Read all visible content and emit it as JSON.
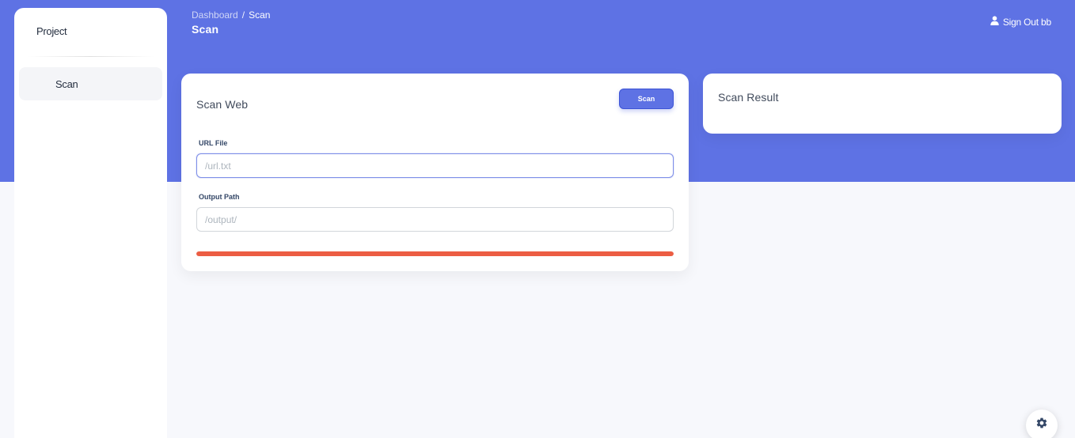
{
  "sidebar": {
    "brand": "Project",
    "items": [
      {
        "label": "Scan",
        "active": true
      }
    ]
  },
  "header": {
    "breadcrumb": {
      "root": "Dashboard",
      "separator": "/",
      "current": "Scan"
    },
    "title": "Scan",
    "signout_label": "Sign Out bb",
    "signout_icon": "user-icon"
  },
  "scan_card": {
    "title": "Scan Web",
    "scan_button": "Scan",
    "url_file": {
      "label": "URL File",
      "placeholder": "/url.txt"
    },
    "output_path": {
      "label": "Output Path",
      "placeholder": "/output/"
    },
    "progress": {
      "percent": 100,
      "color": "#ec5d43"
    }
  },
  "result_card": {
    "title": "Scan Result"
  },
  "settings_icon": "gear-icon",
  "colors": {
    "primary": "#5e72e4",
    "background": "#f7f8fc",
    "progress": "#ec5d43"
  }
}
